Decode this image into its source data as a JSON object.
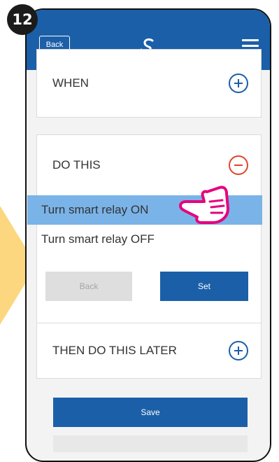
{
  "step": {
    "number": "12"
  },
  "header": {
    "back_label": "Back",
    "logo_icon": "salus-logo-icon",
    "menu_icon": "hamburger-menu-icon"
  },
  "sections": {
    "when": {
      "label": "WHEN",
      "action_icon": "plus-circle-icon"
    },
    "do_this": {
      "label": "DO THIS",
      "action_icon": "minus-circle-icon",
      "options": [
        {
          "label": "Turn smart relay ON",
          "selected": true
        },
        {
          "label": "Turn smart relay OFF",
          "selected": false
        }
      ],
      "back_label": "Back",
      "set_label": "Set"
    },
    "then_later": {
      "label": "THEN DO THIS LATER",
      "action_icon": "plus-circle-icon"
    }
  },
  "footer": {
    "save_label": "Save"
  },
  "colors": {
    "accent": "#1b5fa8",
    "selected_row": "#7ab3e8",
    "minus": "#e0452a",
    "pointer": "#e6007e",
    "arrow": "#fcd77f"
  }
}
